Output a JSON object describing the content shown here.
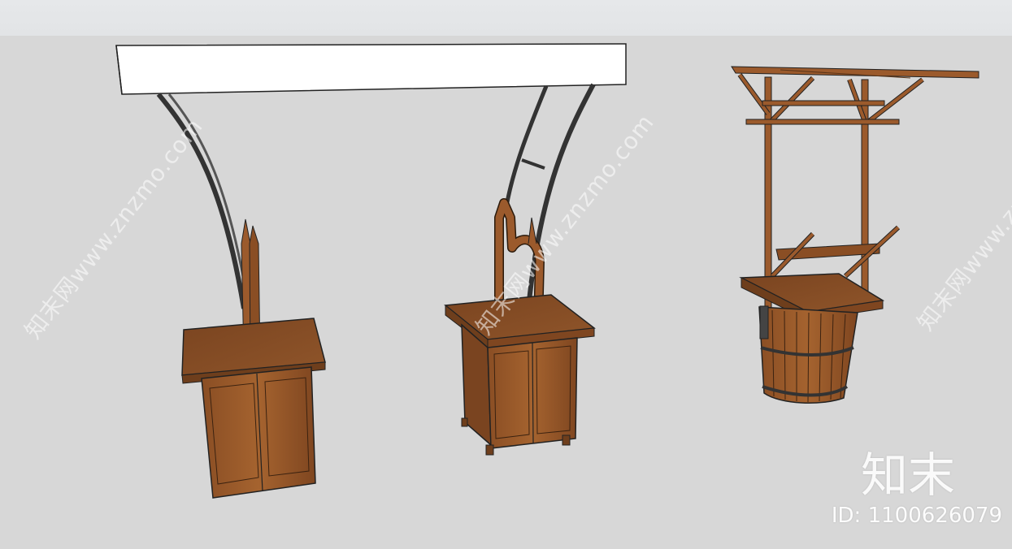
{
  "watermarks": {
    "left": "知末网www.znzmo.com",
    "middle": "知末网www.znzmo.com",
    "right": "知末网www.znzmo.com"
  },
  "brand": "知末",
  "id_label": "ID: 1100626079",
  "colors": {
    "background": "#d7d7d7",
    "wood": "#9b5a2c",
    "wood_dark": "#6e3e1c",
    "sign": "#ffffff",
    "iron": "#3a3a3a"
  }
}
